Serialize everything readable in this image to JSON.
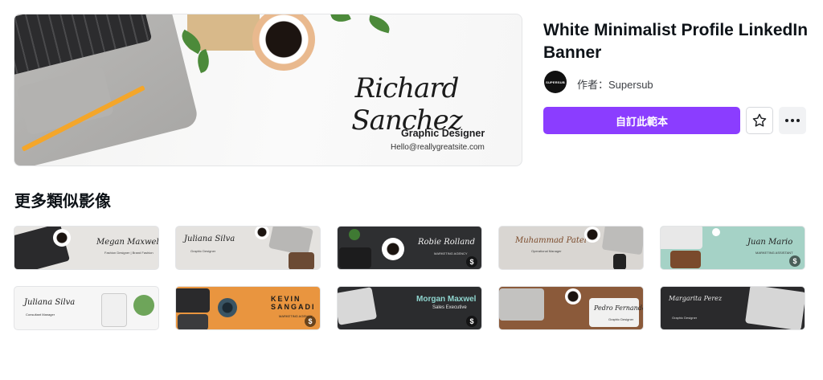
{
  "hero": {
    "signature": "Richard Sanchez",
    "role": "Graphic Designer",
    "email": "Hello@reallygreatsite.com"
  },
  "detail": {
    "title": "White Minimalist Profile LinkedIn Banner",
    "avatar_text": "SUPERSUB",
    "author_prefix": "作者：",
    "author_name": "Supersub",
    "customize_label": "自訂此範本"
  },
  "similar": {
    "title": "更多類似影像",
    "items": [
      {
        "name": "Megan Maxwell",
        "sub": "Fashion Designer | Brand Fashion",
        "bg": "#e6e4e1"
      },
      {
        "name": "Juliana Silva",
        "sub": "Graphic Designer",
        "bg": "#e4e2df"
      },
      {
        "name": "Robie Rolland",
        "sub": "MARKETING AGENCY",
        "bg": "#2e2f31"
      },
      {
        "name": "Muhammad Patel",
        "sub": "Operational Manager",
        "bg": "#d9d6d2"
      },
      {
        "name": "Juan Mario",
        "sub": "MARKETING ASSISTANT",
        "bg": "#a5d2c6"
      },
      {
        "name": "Juliana Silva",
        "sub": "Consultant Manager",
        "bg": "#f6f6f6"
      },
      {
        "name": "KEVIN SANGADI",
        "sub": "MARKETING AGENCY",
        "bg": "#e9953f"
      },
      {
        "name": "Morgan Maxwel",
        "sub": "Sales Executive",
        "bg": "#2b2c2e"
      },
      {
        "name": "Pedro Fernandes",
        "sub": "Graphic Designer",
        "bg": "#8b5a3a"
      },
      {
        "name": "Margarita Perez",
        "sub": "Graphic Designer",
        "bg": "#2a2a2c"
      }
    ]
  },
  "colors": {
    "accent": "#8b3dff"
  },
  "icons": {
    "star": "star-icon",
    "more": "more-icon",
    "premium": "dollar-icon"
  }
}
